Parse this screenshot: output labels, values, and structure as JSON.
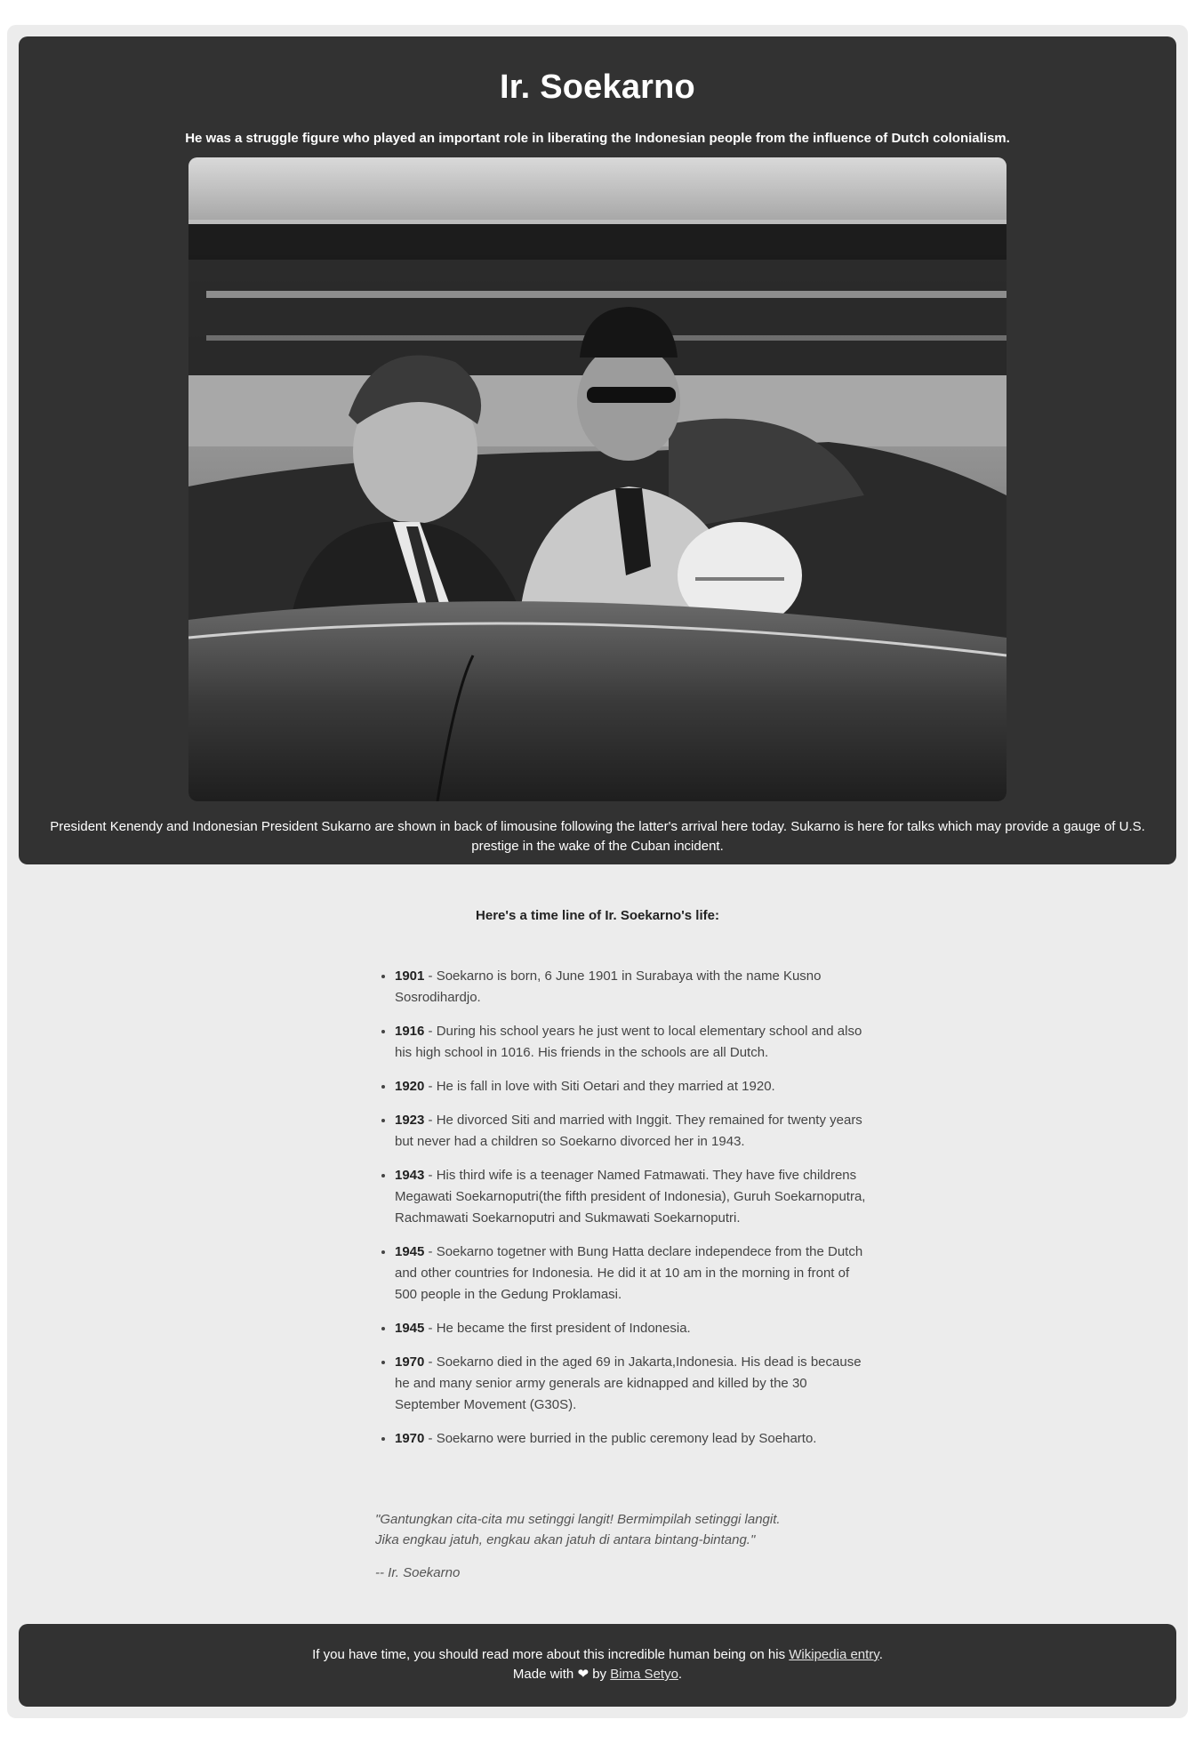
{
  "hero": {
    "title": "Ir. Soekarno",
    "tagline": "He was a struggle figure who played an important role in liberating the Indonesian people from the influence of Dutch colonialism.",
    "caption": "President Kenendy and Indonesian President Sukarno are shown in back of limousine following the latter's arrival here today. Sukarno is here for talks which may provide a gauge of U.S. prestige in the wake of the Cuban incident."
  },
  "timeline": {
    "intro": "Here's a time line of Ir. Soekarno's life:",
    "items": [
      {
        "year": "1901",
        "text": " - Soekarno is born, 6 June 1901 in Surabaya with the name Kusno Sosrodihardjo."
      },
      {
        "year": "1916",
        "text": " - During his school years he just went to local elementary school and also his high school in 1016. His friends in the schools are all Dutch."
      },
      {
        "year": "1920",
        "text": " - He is fall in love with Siti Oetari and they married at 1920."
      },
      {
        "year": "1923",
        "text": " - He divorced Siti and married with Inggit. They remained for twenty years but never had a children so Soekarno divorced her in 1943."
      },
      {
        "year": "1943",
        "text": " - His third wife is a teenager Named Fatmawati. They have five childrens Megawati Soekarnoputri(the fifth president of Indonesia), Guruh Soekarnoputra, Rachmawati Soekarnoputri and Sukmawati Soekarnoputri."
      },
      {
        "year": "1945",
        "text": " - Soekarno togetner with Bung Hatta declare independece from the Dutch and other countries for Indonesia. He did it at 10 am in the morning in front of 500 people in the Gedung Proklamasi."
      },
      {
        "year": "1945",
        "text": " - He became the first president of Indonesia."
      },
      {
        "year": "1970",
        "text": " - Soekarno died in the aged 69 in Jakarta,Indonesia. His dead is because he and many senior army generals are kidnapped and killed by the 30 September Movement (G30S)."
      },
      {
        "year": "1970",
        "text": " - Soekarno were burried in the public ceremony lead by Soeharto."
      }
    ]
  },
  "quote": {
    "line1": "\"Gantungkan cita-cita mu setinggi langit! Bermimpilah setinggi langit.",
    "line2": "Jika engkau jatuh, engkau akan jatuh di antara bintang-bintang.\"",
    "author": "-- Ir. Soekarno"
  },
  "footer": {
    "text_before": "If you have time, you should read more about this incredible human being on his ",
    "wiki_link": "Wikipedia entry",
    "text_after": ".",
    "made_with": "Made with ",
    "heart": "❤",
    "by": " by ",
    "author_link": "Bima Setyo",
    "end": "."
  },
  "icons": {
    "heart": "heart-icon"
  }
}
